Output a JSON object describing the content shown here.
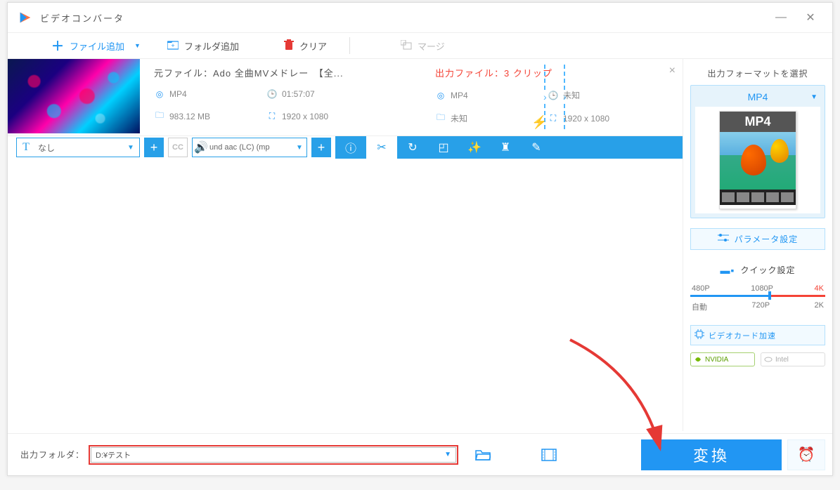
{
  "window": {
    "title": "ビデオコンバータ"
  },
  "toolbar": {
    "add_file": "ファイル追加",
    "add_folder": "フォルダ追加",
    "clear": "クリア",
    "merge": "マージ"
  },
  "file": {
    "source_label": "元ファイル：",
    "source_name": "Ado 全曲MVメドレー　【全...",
    "src_format": "MP4",
    "src_duration": "01:57:07",
    "src_size": "983.12 MB",
    "src_resolution": "1920 x 1080",
    "output_label": "出力ファイル：",
    "output_clips": "3 クリップ",
    "out_format": "MP4",
    "out_duration": "未知",
    "out_size": "未知",
    "out_resolution": "1920 x 1080"
  },
  "tracks": {
    "subtitle": "なし",
    "audio": "und aac (LC) (mp"
  },
  "right": {
    "title": "出力フォーマットを選択",
    "format": "MP4",
    "format_card": "MP4",
    "param_btn": "パラメータ設定",
    "quick_title": "クイック設定",
    "res_top": {
      "a": "480P",
      "b": "1080P",
      "c": "4K"
    },
    "res_bot": {
      "a": "自動",
      "b": "720P",
      "c": "2K"
    },
    "gpu": "ビデオカード加速",
    "nvidia": "NVIDIA",
    "intel": "Intel"
  },
  "bottom": {
    "label": "出力フォルダ：",
    "path": "D:¥テスト",
    "convert": "変換"
  }
}
